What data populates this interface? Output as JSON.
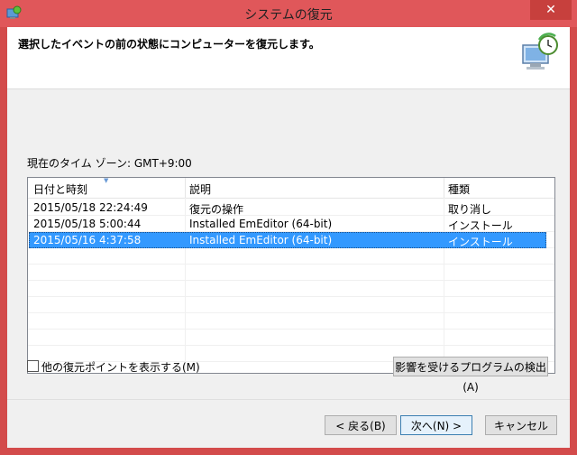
{
  "window": {
    "title": "システムの復元",
    "close_label": "✕"
  },
  "header": {
    "instruction": "選択したイベントの前の状態にコンピューターを復元します。"
  },
  "timezone": "現在のタイム ゾーン: GMT+9:00",
  "list": {
    "columns": [
      "日付と時刻",
      "説明",
      "種類"
    ],
    "rows": [
      {
        "date": "2015/05/18 22:24:49",
        "description": "復元の操作",
        "type": "取り消し",
        "selected": false
      },
      {
        "date": "2015/05/18 5:00:44",
        "description": "Installed EmEditor (64-bit)",
        "type": "インストール",
        "selected": false
      },
      {
        "date": "2015/05/16 4:37:58",
        "description": "Installed EmEditor (64-bit)",
        "type": "インストール",
        "selected": true
      }
    ]
  },
  "checkbox": {
    "label": "他の復元ポイントを表示する(M)",
    "checked": false
  },
  "buttons": {
    "scan": "影響を受けるプログラムの検出(A)",
    "back": "< 戻る(B)",
    "next": "次へ(N) >",
    "cancel": "キャンセル"
  },
  "colors": {
    "title_bar": "#e0575a",
    "selection": "#3399ff"
  },
  "icons": {
    "app": "system-restore-icon",
    "header": "restore-computer-clock-icon"
  }
}
